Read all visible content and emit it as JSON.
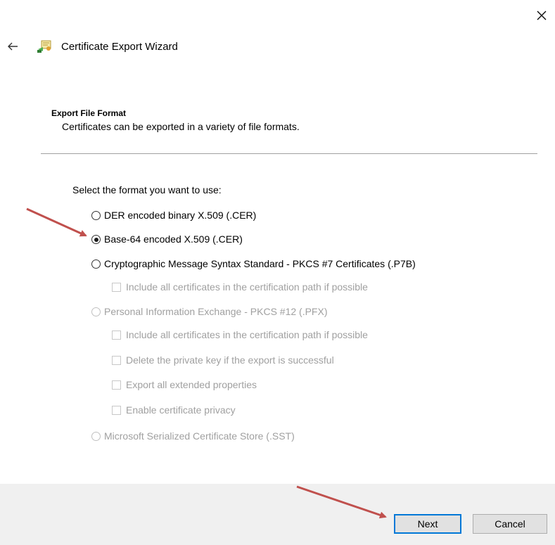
{
  "window": {
    "title": "Certificate Export Wizard",
    "close_icon": "close-icon",
    "back_icon": "back-arrow-icon",
    "app_icon": "certificate-icon"
  },
  "section": {
    "heading": "Export File Format",
    "description": "Certificates can be exported in a variety of file formats."
  },
  "prompt": "Select the format you want to use:",
  "options": [
    {
      "type": "radio",
      "label": "DER encoded binary X.509 (.CER)",
      "checked": false,
      "enabled": true
    },
    {
      "type": "radio",
      "label": "Base-64 encoded X.509 (.CER)",
      "checked": true,
      "enabled": true
    },
    {
      "type": "radio",
      "label": "Cryptographic Message Syntax Standard - PKCS #7 Certificates (.P7B)",
      "checked": false,
      "enabled": true
    },
    {
      "type": "checkbox",
      "label": "Include all certificates in the certification path if possible",
      "checked": false,
      "enabled": false
    },
    {
      "type": "radio",
      "label": "Personal Information Exchange - PKCS #12 (.PFX)",
      "checked": false,
      "enabled": false
    },
    {
      "type": "checkbox",
      "label": "Include all certificates in the certification path if possible",
      "checked": false,
      "enabled": false
    },
    {
      "type": "checkbox",
      "label": "Delete the private key if the export is successful",
      "checked": false,
      "enabled": false
    },
    {
      "type": "checkbox",
      "label": "Export all extended properties",
      "checked": false,
      "enabled": false
    },
    {
      "type": "checkbox",
      "label": "Enable certificate privacy",
      "checked": false,
      "enabled": false
    },
    {
      "type": "radio",
      "label": "Microsoft Serialized Certificate Store (.SST)",
      "checked": false,
      "enabled": false
    }
  ],
  "buttons": {
    "next": "Next",
    "cancel": "Cancel"
  },
  "colors": {
    "annotation_arrow": "#c0504d",
    "default_button_border": "#0078d7",
    "footer_bg": "#f0f0f0",
    "disabled_text": "#a0a0a0"
  }
}
